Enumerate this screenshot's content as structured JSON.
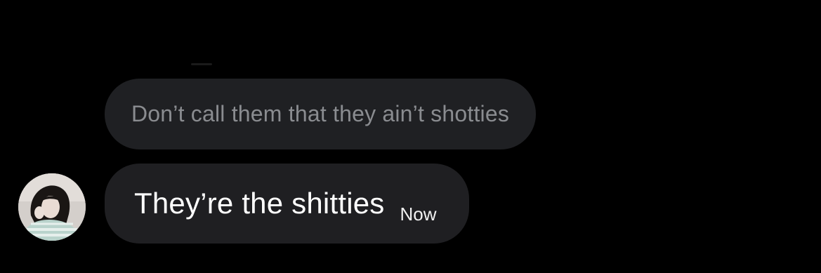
{
  "conversation": {
    "messages": [
      {
        "text": "Don’t call them that they ain’t shotties",
        "style": "reply-quote"
      },
      {
        "text": "They’re the shitties",
        "timestamp": "Now",
        "style": "received"
      }
    ]
  },
  "avatar": {
    "icon": "profile-photo"
  },
  "colors": {
    "background": "#000000",
    "bubble": "#1f1f22",
    "quote_text": "#8a8c90",
    "message_text": "#ffffff"
  }
}
